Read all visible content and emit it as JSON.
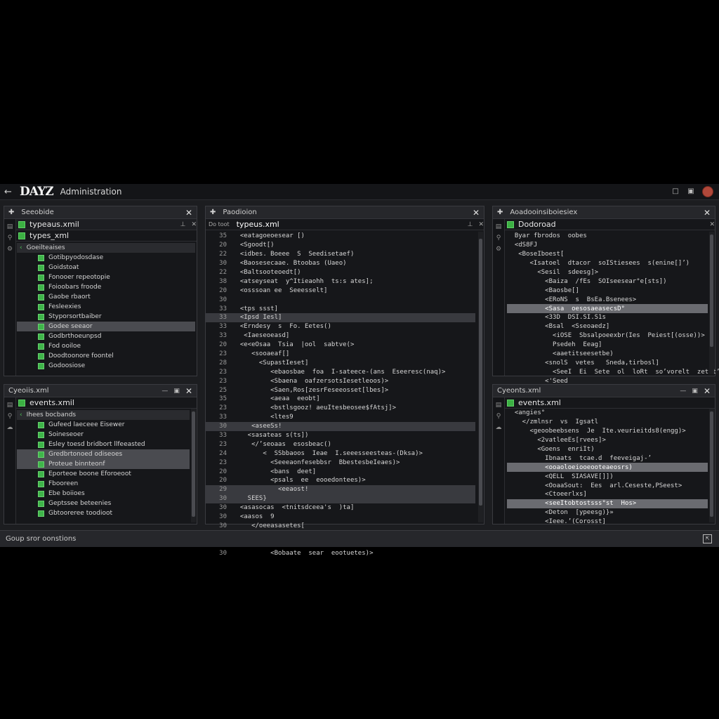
{
  "app": {
    "logo": "DAYZ",
    "title": "Administration",
    "back_glyph": "←"
  },
  "panels": {
    "top_left": {
      "header": "Seeobide",
      "file": "typeaus.xmil",
      "file2": "types_xml",
      "items": [
        {
          "label": "Goeilteaises",
          "kind": "hdr"
        },
        {
          "label": "Gotibpyodosdase",
          "kind": "item"
        },
        {
          "label": "Goidstoat",
          "kind": "item"
        },
        {
          "label": "Fonooer repeotopie",
          "kind": "item"
        },
        {
          "label": "Foioobars froode",
          "kind": "item"
        },
        {
          "label": "Gaobe rbaort",
          "kind": "item"
        },
        {
          "label": "Fesleexies",
          "kind": "item"
        },
        {
          "label": "Styporsortbaiber",
          "kind": "item"
        },
        {
          "label": "Godee seeaor",
          "kind": "sel"
        },
        {
          "label": "Godbrthoeunpsd",
          "kind": "item"
        },
        {
          "label": "Fod ooiloe",
          "kind": "item"
        },
        {
          "label": "Doodtoonore foontel",
          "kind": "item"
        },
        {
          "label": "Godoosiose",
          "kind": "item"
        }
      ]
    },
    "bottom_left": {
      "header": "Cyeoiis.xml",
      "file": "events.xmil",
      "items": [
        {
          "label": "Ihees bocbands",
          "kind": "hdr"
        },
        {
          "label": "Gufeed laeceee Eisewer",
          "kind": "item"
        },
        {
          "label": "Soineseoer",
          "kind": "item"
        },
        {
          "label": "Esley toesd bridbort llfeeasted",
          "kind": "item"
        },
        {
          "label": "Gredbrtonoed odiseoes",
          "kind": "sel"
        },
        {
          "label": "Proteue binnteonf",
          "kind": "sel"
        },
        {
          "label": "Eporteoe boone Eforoeoot",
          "kind": "item"
        },
        {
          "label": "Fbooreen",
          "kind": "item"
        },
        {
          "label": "Ebe boiioes",
          "kind": "item"
        },
        {
          "label": "Geptssee beteenies",
          "kind": "item"
        },
        {
          "label": "Gbtooreree toodioot",
          "kind": "item"
        }
      ]
    },
    "middle": {
      "header": "Paodioion",
      "tab_small": "Do toot",
      "file": "typeus.xml",
      "lines": [
        {
          "n": "35",
          "t": "  <eatagoeoesear [)",
          "hl": ""
        },
        {
          "n": "20",
          "t": "  <Sgoodt[)",
          "hl": ""
        },
        {
          "n": "22",
          "t": "  <idbes. Boeee  S  Seedisetaef)",
          "hl": ""
        },
        {
          "n": "30",
          "t": "  <Baosesecaae. Btoobas (Uaeo)",
          "hl": ""
        },
        {
          "n": "22",
          "t": "  <Baltsooteoedt[)",
          "hl": ""
        },
        {
          "n": "38",
          "t": "  <atseyseat  y^Itieaohh  ts:s ates];",
          "hl": ""
        },
        {
          "n": "20",
          "t": "  <osssoan ee  Seeesselt]",
          "hl": ""
        },
        {
          "n": "30",
          "t": "",
          "hl": ""
        },
        {
          "n": "33",
          "t": "  <tps ssst]",
          "hl": ""
        },
        {
          "n": "33",
          "t": "  <Ipsd Iesl]",
          "hl": "hl"
        },
        {
          "n": "33",
          "t": "  <Erndesy  s  Fo. Eetes()",
          "hl": ""
        },
        {
          "n": "33",
          "t": "   <Iaeseoeasd]",
          "hl": ""
        },
        {
          "n": "20",
          "t": "  <e<eOsaa  Tsia  |ool  sabtve(>",
          "hl": ""
        },
        {
          "n": "23",
          "t": "     <sooaeaf[]",
          "hl": ""
        },
        {
          "n": "28",
          "t": "       <SupastIeset]",
          "hl": ""
        },
        {
          "n": "23",
          "t": "          <ebaosbae  foa  I-sateece-(ans  Eseeresc(naq)>",
          "hl": ""
        },
        {
          "n": "23",
          "t": "          <Sbaena  oafzersotsIesetleoos)>",
          "hl": ""
        },
        {
          "n": "25",
          "t": "          <Saen,Ros[zesrFeseeosset[lbes]>",
          "hl": ""
        },
        {
          "n": "35",
          "t": "          <aeaa  eeobt]",
          "hl": ""
        },
        {
          "n": "23",
          "t": "          <bstlsgooz! aeuItesbeosee$fAtsj]>",
          "hl": ""
        },
        {
          "n": "33",
          "t": "          <ltes9",
          "hl": ""
        },
        {
          "n": "30",
          "t": "     <aseeSs!",
          "hl": "hl"
        },
        {
          "n": "33",
          "t": "    <sasateas s(ts])",
          "hl": ""
        },
        {
          "n": "23",
          "t": "     </’seoaas  esosbeac()",
          "hl": ""
        },
        {
          "n": "24",
          "t": "        <  SSbbaoos  Ieae  I.seeesseesteas-(Dksa)>",
          "hl": ""
        },
        {
          "n": "23",
          "t": "          <Seeeaonfesebbsr  BbestesbeIeaes)>",
          "hl": ""
        },
        {
          "n": "20",
          "t": "          <bans  deet]",
          "hl": ""
        },
        {
          "n": "20",
          "t": "          <psals  ee  eooedontees)>",
          "hl": ""
        },
        {
          "n": "29",
          "t": "            <eeaost!",
          "hl": "hl"
        },
        {
          "n": "30",
          "t": "    SEES}",
          "hl": "hl"
        },
        {
          "n": "30",
          "t": "  <asasocas  <tnitsdceea's  )ta]",
          "hl": ""
        },
        {
          "n": "30",
          "t": "  <aasos  9",
          "hl": ""
        },
        {
          "n": "30",
          "t": "     </oeeasasetes[",
          "hl": ""
        },
        {
          "n": "25",
          "t": "        <Sbaotas  Ieaa  I-seeesteseteeess-(Dksa)>",
          "hl": ""
        },
        {
          "n": "23",
          "t": "          <Bsesa  oaL[sear-Stesestseteess)>",
          "hl": ""
        },
        {
          "n": "30",
          "t": "          <Bobaate  sear  eootuetes)>",
          "hl": ""
        }
      ]
    },
    "top_right": {
      "header": "Aoadooinsiboiesiex",
      "file": "Dodoroad",
      "lines": [
        {
          "t": "  Byar fbrodos  oobes",
          "hl": ""
        },
        {
          "t": "  <dS8FJ",
          "hl": ""
        },
        {
          "t": "   <BoseIboest[",
          "hl": ""
        },
        {
          "t": "      <Isatoel  dtacor  soIStiesees  s(enine[]’)",
          "hl": ""
        },
        {
          "t": "        <Sesil  sdeesg]>",
          "hl": ""
        },
        {
          "t": "          <Baiza  /fEs  SOIseesear°e[sts])",
          "hl": ""
        },
        {
          "t": "          <Baosbe[]",
          "hl": ""
        },
        {
          "t": "          <ERoNS  s  BsEa.Bsenees>",
          "hl": ""
        },
        {
          "t": "          <Sasa  oesosaeasecsD°",
          "hl": "hlw"
        },
        {
          "t": "          <33D  DSI.SI.S1s",
          "hl": ""
        },
        {
          "t": "          <Bsal  <Sseoaedz]",
          "hl": ""
        },
        {
          "t": "            <iOSE  Sbsalpoeexbr(Ies  Peiest[(osse))>",
          "hl": ""
        },
        {
          "t": "            Psedeh  Eeag]",
          "hl": ""
        },
        {
          "t": "            <aaetitseesetbe)",
          "hl": ""
        },
        {
          "t": "          <snolS  vetes   Sneda,tirbosl]",
          "hl": ""
        },
        {
          "t": "            <SeeI  Ei  Sete  ol  loRt  so’vorelt  zetst’>",
          "hl": ""
        },
        {
          "t": "          <'Seed",
          "hl": ""
        },
        {
          "t": "      </ies",
          "hl": ""
        }
      ]
    },
    "bottom_right": {
      "header": "Cyeonts.xml",
      "file": "events.xml",
      "lines": [
        {
          "t": "  <angies°",
          "hl": ""
        },
        {
          "t": "    </zmlnsr  vs  Igsatl",
          "hl": ""
        },
        {
          "t": "      <geoobeebsens  Je  Ite.veurieitds8(engg)>",
          "hl": ""
        },
        {
          "t": "        <2vatleeEs[rvees]>",
          "hl": ""
        },
        {
          "t": "        <Goens  enriIt)",
          "hl": ""
        },
        {
          "t": "          Ibnaats  tcae.d  feeveigaj-’",
          "hl": ""
        },
        {
          "t": "          <ooaoloeiooeooteaeosrs)",
          "hl": "hlw"
        },
        {
          "t": "          <QELL  SIASAVE[]])",
          "hl": ""
        },
        {
          "t": "          <OoaaSout:  Ees  arl.Ceseste,PSeest>",
          "hl": ""
        },
        {
          "t": "          <Ctoeerlxs]",
          "hl": ""
        },
        {
          "t": "          <seeItobtostsss°st  Hos>",
          "hl": "hlw"
        },
        {
          "t": "          <Deton  [ypeesg)}»",
          "hl": ""
        },
        {
          "t": "          <Ieee.’(Corosst]",
          "hl": ""
        }
      ]
    }
  },
  "status": {
    "text": "Goup sror oonstions"
  },
  "colors": {
    "accent_green": "#3cb043",
    "panel_bg": "#16171a",
    "selection": "#4a4b50"
  }
}
